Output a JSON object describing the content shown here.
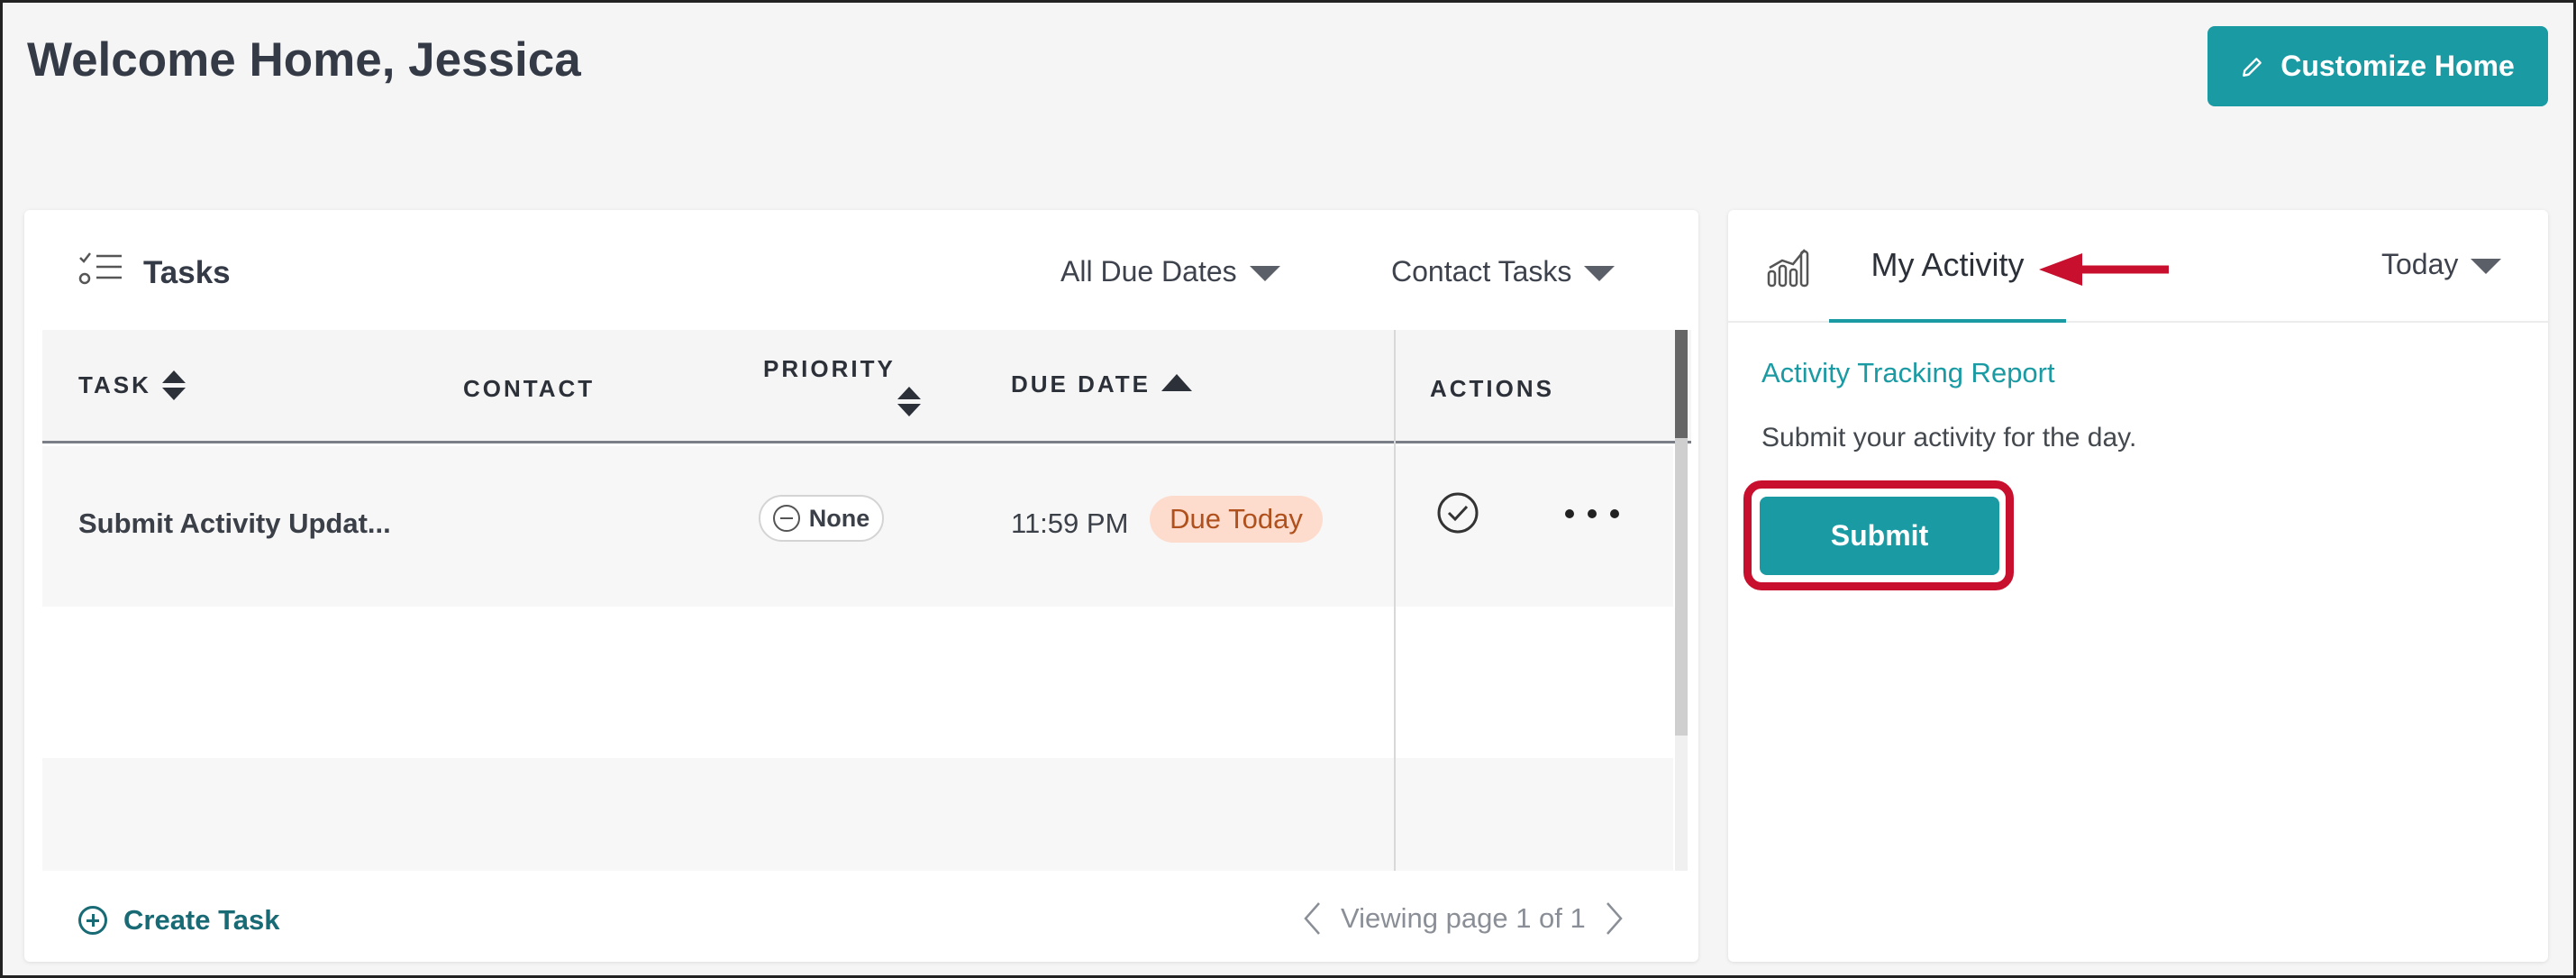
{
  "header": {
    "welcome": "Welcome Home, Jessica",
    "customize_label": "Customize Home"
  },
  "tasks": {
    "title": "Tasks",
    "filters": {
      "due_dates": "All Due Dates",
      "task_type": "Contact Tasks"
    },
    "columns": {
      "task": "TASK",
      "contact": "CONTACT",
      "priority": "PRIORITY",
      "due_date": "DUE DATE",
      "actions": "ACTIONS"
    },
    "rows": [
      {
        "task": "Submit Activity Updat...",
        "contact": "",
        "priority": "None",
        "due_time": "11:59 PM",
        "due_badge": "Due Today"
      }
    ],
    "footer": {
      "create_label": "Create Task",
      "pager": "Viewing page 1 of 1"
    }
  },
  "activity": {
    "tab_label": "My Activity",
    "range": "Today",
    "report_link": "Activity Tracking Report",
    "description": "Submit your activity for the day.",
    "submit_label": "Submit"
  },
  "colors": {
    "accent": "#1a9aa3",
    "highlight": "#c8102e",
    "badge_bg": "#fddccd",
    "badge_text": "#b0501c"
  }
}
